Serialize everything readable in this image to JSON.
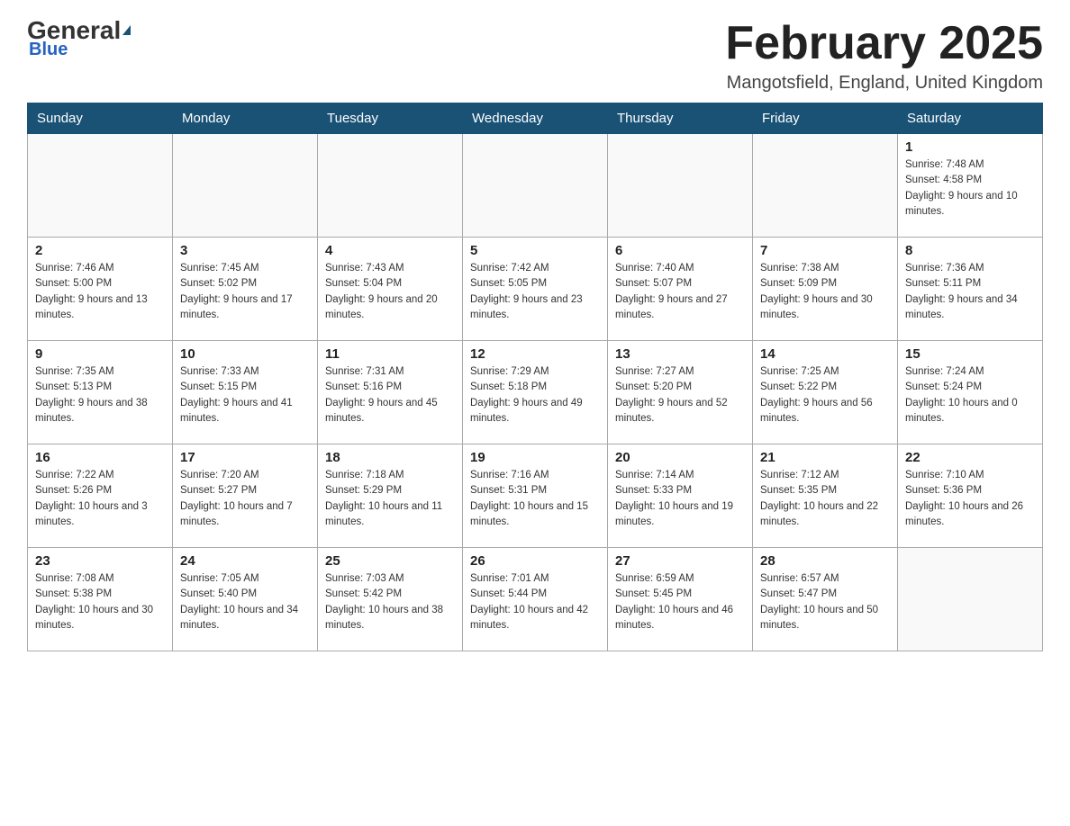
{
  "header": {
    "logo_general": "General",
    "logo_blue": "Blue",
    "month_title": "February 2025",
    "location": "Mangotsfield, England, United Kingdom"
  },
  "days_of_week": [
    "Sunday",
    "Monday",
    "Tuesday",
    "Wednesday",
    "Thursday",
    "Friday",
    "Saturday"
  ],
  "weeks": [
    [
      {
        "day": "",
        "info": ""
      },
      {
        "day": "",
        "info": ""
      },
      {
        "day": "",
        "info": ""
      },
      {
        "day": "",
        "info": ""
      },
      {
        "day": "",
        "info": ""
      },
      {
        "day": "",
        "info": ""
      },
      {
        "day": "1",
        "info": "Sunrise: 7:48 AM\nSunset: 4:58 PM\nDaylight: 9 hours and 10 minutes."
      }
    ],
    [
      {
        "day": "2",
        "info": "Sunrise: 7:46 AM\nSunset: 5:00 PM\nDaylight: 9 hours and 13 minutes."
      },
      {
        "day": "3",
        "info": "Sunrise: 7:45 AM\nSunset: 5:02 PM\nDaylight: 9 hours and 17 minutes."
      },
      {
        "day": "4",
        "info": "Sunrise: 7:43 AM\nSunset: 5:04 PM\nDaylight: 9 hours and 20 minutes."
      },
      {
        "day": "5",
        "info": "Sunrise: 7:42 AM\nSunset: 5:05 PM\nDaylight: 9 hours and 23 minutes."
      },
      {
        "day": "6",
        "info": "Sunrise: 7:40 AM\nSunset: 5:07 PM\nDaylight: 9 hours and 27 minutes."
      },
      {
        "day": "7",
        "info": "Sunrise: 7:38 AM\nSunset: 5:09 PM\nDaylight: 9 hours and 30 minutes."
      },
      {
        "day": "8",
        "info": "Sunrise: 7:36 AM\nSunset: 5:11 PM\nDaylight: 9 hours and 34 minutes."
      }
    ],
    [
      {
        "day": "9",
        "info": "Sunrise: 7:35 AM\nSunset: 5:13 PM\nDaylight: 9 hours and 38 minutes."
      },
      {
        "day": "10",
        "info": "Sunrise: 7:33 AM\nSunset: 5:15 PM\nDaylight: 9 hours and 41 minutes."
      },
      {
        "day": "11",
        "info": "Sunrise: 7:31 AM\nSunset: 5:16 PM\nDaylight: 9 hours and 45 minutes."
      },
      {
        "day": "12",
        "info": "Sunrise: 7:29 AM\nSunset: 5:18 PM\nDaylight: 9 hours and 49 minutes."
      },
      {
        "day": "13",
        "info": "Sunrise: 7:27 AM\nSunset: 5:20 PM\nDaylight: 9 hours and 52 minutes."
      },
      {
        "day": "14",
        "info": "Sunrise: 7:25 AM\nSunset: 5:22 PM\nDaylight: 9 hours and 56 minutes."
      },
      {
        "day": "15",
        "info": "Sunrise: 7:24 AM\nSunset: 5:24 PM\nDaylight: 10 hours and 0 minutes."
      }
    ],
    [
      {
        "day": "16",
        "info": "Sunrise: 7:22 AM\nSunset: 5:26 PM\nDaylight: 10 hours and 3 minutes."
      },
      {
        "day": "17",
        "info": "Sunrise: 7:20 AM\nSunset: 5:27 PM\nDaylight: 10 hours and 7 minutes."
      },
      {
        "day": "18",
        "info": "Sunrise: 7:18 AM\nSunset: 5:29 PM\nDaylight: 10 hours and 11 minutes."
      },
      {
        "day": "19",
        "info": "Sunrise: 7:16 AM\nSunset: 5:31 PM\nDaylight: 10 hours and 15 minutes."
      },
      {
        "day": "20",
        "info": "Sunrise: 7:14 AM\nSunset: 5:33 PM\nDaylight: 10 hours and 19 minutes."
      },
      {
        "day": "21",
        "info": "Sunrise: 7:12 AM\nSunset: 5:35 PM\nDaylight: 10 hours and 22 minutes."
      },
      {
        "day": "22",
        "info": "Sunrise: 7:10 AM\nSunset: 5:36 PM\nDaylight: 10 hours and 26 minutes."
      }
    ],
    [
      {
        "day": "23",
        "info": "Sunrise: 7:08 AM\nSunset: 5:38 PM\nDaylight: 10 hours and 30 minutes."
      },
      {
        "day": "24",
        "info": "Sunrise: 7:05 AM\nSunset: 5:40 PM\nDaylight: 10 hours and 34 minutes."
      },
      {
        "day": "25",
        "info": "Sunrise: 7:03 AM\nSunset: 5:42 PM\nDaylight: 10 hours and 38 minutes."
      },
      {
        "day": "26",
        "info": "Sunrise: 7:01 AM\nSunset: 5:44 PM\nDaylight: 10 hours and 42 minutes."
      },
      {
        "day": "27",
        "info": "Sunrise: 6:59 AM\nSunset: 5:45 PM\nDaylight: 10 hours and 46 minutes."
      },
      {
        "day": "28",
        "info": "Sunrise: 6:57 AM\nSunset: 5:47 PM\nDaylight: 10 hours and 50 minutes."
      },
      {
        "day": "",
        "info": ""
      }
    ]
  ]
}
